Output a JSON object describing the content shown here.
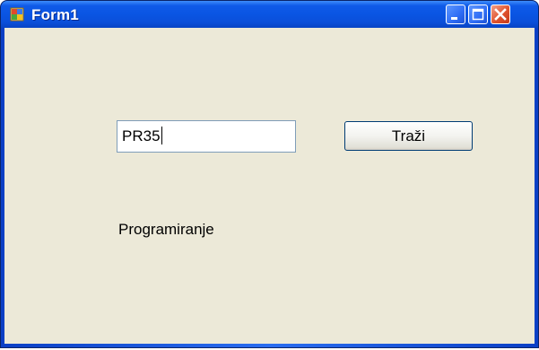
{
  "window": {
    "title": "Form1",
    "icon": "form-app-icon"
  },
  "titlebar_buttons": {
    "minimize": "minimize-icon",
    "maximize": "maximize-icon",
    "close": "close-icon"
  },
  "form": {
    "textbox_value": "PR35",
    "search_button_label": "Traži",
    "result_label": "Programiranje"
  },
  "colors": {
    "titlebar": "#0a55e3",
    "client_background": "#ece9d8",
    "close_button": "#e0532d"
  }
}
